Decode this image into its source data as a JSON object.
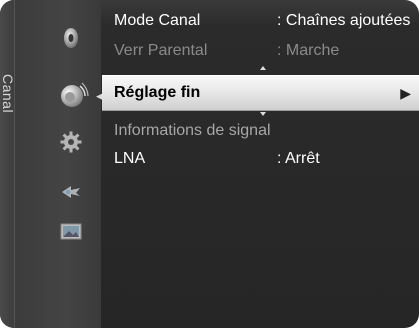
{
  "sidebar": {
    "title": "Canal",
    "icons": [
      "disc-icon",
      "satellite-dish-icon",
      "gear-icon",
      "input-source-icon",
      "picture-icon"
    ]
  },
  "menu": {
    "items": [
      {
        "label": "Mode Canal",
        "value": ": Chaînes ajoutées",
        "state": "normal"
      },
      {
        "label": "Verr Parental",
        "value": ": Marche",
        "state": "disabled"
      },
      {
        "label": "Réglage fin",
        "value": "",
        "state": "selected",
        "indicator": "▶"
      },
      {
        "label": "Informations de signal",
        "value": "",
        "state": "dim"
      },
      {
        "label": "LNA",
        "value": ": Arrêt",
        "state": "normal"
      }
    ]
  },
  "colors": {
    "background": "#262626",
    "highlight": "#eeeeee",
    "text": "#ffffff",
    "disabled": "#8a8a8a"
  }
}
